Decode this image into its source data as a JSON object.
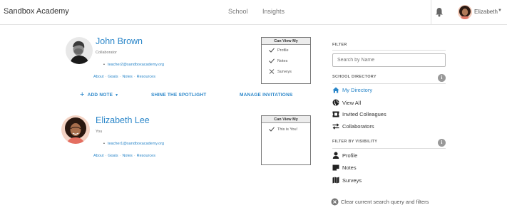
{
  "header": {
    "brand": "Sandbox Academy",
    "nav": [
      "School",
      "Insights"
    ],
    "user_name": "Elizabeth"
  },
  "people": [
    {
      "name": "John Brown",
      "role": "Collaborator",
      "email": "teacher2@sandboxacademy.org",
      "links": [
        "About",
        "Goals",
        "Notes",
        "Resources"
      ],
      "can_view": {
        "title": "Can View My",
        "items": [
          {
            "label": "Profile",
            "allowed": true
          },
          {
            "label": "Notes",
            "allowed": true
          },
          {
            "label": "Surveys",
            "allowed": false
          }
        ]
      }
    },
    {
      "name": "Elizabeth Lee",
      "role": "You",
      "email": "teacher1@sandboxacademy.org",
      "links": [
        "About",
        "Goals",
        "Notes",
        "Resources"
      ],
      "can_view": {
        "title": "Can View My",
        "items": [
          {
            "label": "This is You!",
            "allowed": true
          }
        ]
      }
    }
  ],
  "actions": {
    "add_note": "ADD NOTE",
    "spotlight": "SHINE THE SPOTLIGHT",
    "invitations": "MANAGE INVITATIONS"
  },
  "sidebar": {
    "filter_title": "FILTER",
    "search_placeholder": "Search by Name",
    "directory_title": "SCHOOL DIRECTORY",
    "directory_items": [
      {
        "label": "My Directory",
        "icon": "home-icon",
        "active": true
      },
      {
        "label": "View All",
        "icon": "globe-icon",
        "active": false
      },
      {
        "label": "Invited Colleagues",
        "icon": "ticket-icon",
        "active": false
      },
      {
        "label": "Collaborators",
        "icon": "exchange-icon",
        "active": false
      }
    ],
    "visibility_title": "FILTER BY VISIBILITY",
    "visibility_items": [
      {
        "label": "Profile",
        "icon": "user-icon"
      },
      {
        "label": "Notes",
        "icon": "note-icon"
      },
      {
        "label": "Surveys",
        "icon": "map-icon"
      }
    ],
    "clear_label": "Clear current search query and filters"
  },
  "colors": {
    "accent": "#2a86c9",
    "muted": "#777777"
  }
}
